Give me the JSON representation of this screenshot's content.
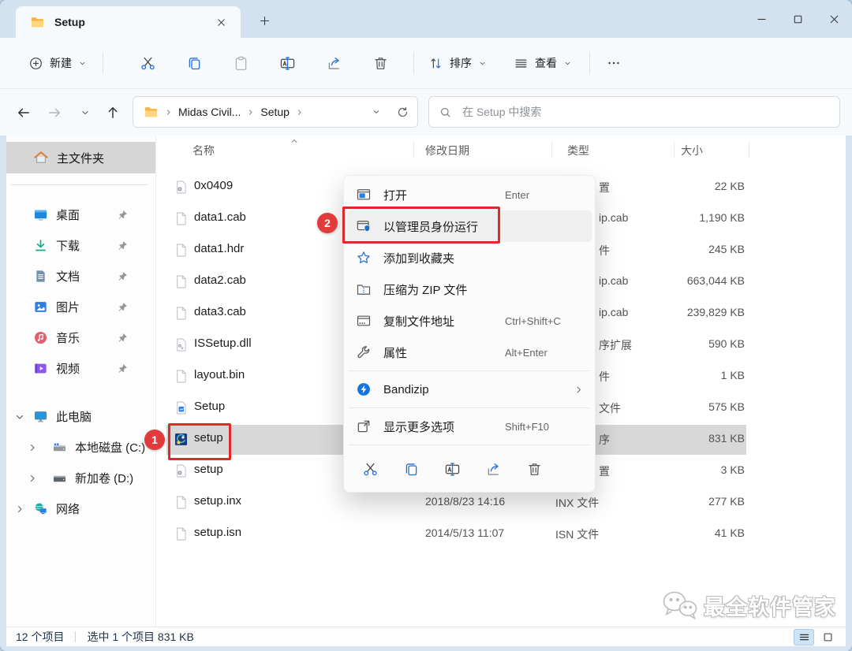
{
  "window": {
    "tab": {
      "title": "Setup"
    }
  },
  "toolbar": {
    "new_label": "新建",
    "sort_label": "排序",
    "view_label": "查看",
    "buttons": [
      {
        "name": "cut",
        "icon": "cut-icon",
        "enabled": true
      },
      {
        "name": "copy",
        "icon": "copy-icon",
        "enabled": true
      },
      {
        "name": "paste",
        "icon": "paste-icon",
        "enabled": false
      },
      {
        "name": "rename",
        "icon": "rename-icon",
        "enabled": true
      },
      {
        "name": "share",
        "icon": "share-icon",
        "enabled": true
      },
      {
        "name": "delete",
        "icon": "delete-icon",
        "enabled": true
      }
    ]
  },
  "address": {
    "crumbs": [
      "Midas Civil...",
      "Setup"
    ]
  },
  "search": {
    "placeholder": "在 Setup 中搜索"
  },
  "sidebar": {
    "home": {
      "label": "主文件夹"
    },
    "quick_items": [
      {
        "label": "桌面",
        "icon": "desktop-icon",
        "pinned": true
      },
      {
        "label": "下载",
        "icon": "downloads-icon",
        "pinned": true
      },
      {
        "label": "文档",
        "icon": "documents-icon",
        "pinned": true
      },
      {
        "label": "图片",
        "icon": "pictures-icon",
        "pinned": true
      },
      {
        "label": "音乐",
        "icon": "music-icon",
        "pinned": true
      },
      {
        "label": "视频",
        "icon": "videos-icon",
        "pinned": true
      }
    ],
    "tree_items": [
      {
        "label": "此电脑",
        "icon": "computer-icon",
        "chevron": "down",
        "indent": 0
      },
      {
        "label": "本地磁盘 (C:)",
        "icon": "disk-c-icon",
        "chevron": "right",
        "indent": 1
      },
      {
        "label": "新加卷 (D:)",
        "icon": "disk-d-icon",
        "chevron": "right",
        "indent": 1
      },
      {
        "label": "网络",
        "icon": "network-icon",
        "chevron": "right",
        "indent": 0
      }
    ]
  },
  "files": {
    "headers": {
      "name": "名称",
      "date": "修改日期",
      "type": "类型",
      "size": "大小"
    },
    "rows": [
      {
        "name": "0x0409",
        "icon": "config-file-icon",
        "type_fragment": "置",
        "size": "22 KB"
      },
      {
        "name": "data1.cab",
        "icon": "file-icon",
        "type_fragment": "ip.cab",
        "size": "1,190 KB"
      },
      {
        "name": "data1.hdr",
        "icon": "file-icon",
        "type_fragment": "件",
        "size": "245 KB"
      },
      {
        "name": "data2.cab",
        "icon": "file-icon",
        "type_fragment": "ip.cab",
        "size": "663,044 KB"
      },
      {
        "name": "data3.cab",
        "icon": "file-icon",
        "type_fragment": "ip.cab",
        "size": "239,829 KB"
      },
      {
        "name": "ISSetup.dll",
        "icon": "dll-file-icon",
        "type_fragment": "序扩展",
        "size": "590 KB"
      },
      {
        "name": "layout.bin",
        "icon": "file-icon",
        "type_fragment": "件",
        "size": "1 KB"
      },
      {
        "name": "Setup",
        "icon": "setup-doc-icon",
        "type_fragment": "文件",
        "size": "575 KB"
      },
      {
        "name": "setup",
        "icon": "setup-exe-icon",
        "type_fragment": "序",
        "size": "831 KB",
        "selected": true
      },
      {
        "name": "setup",
        "icon": "config-file-icon",
        "type_fragment": "置",
        "size": "3 KB"
      },
      {
        "name": "setup.inx",
        "icon": "file-icon",
        "date": "2018/8/23 14:16",
        "type": "INX 文件",
        "size": "277 KB"
      },
      {
        "name": "setup.isn",
        "icon": "file-icon",
        "date": "2014/5/13 11:07",
        "type": "ISN 文件",
        "size": "41 KB"
      }
    ]
  },
  "context_menu": {
    "items": [
      {
        "kind": "item",
        "name": "open",
        "icon": "open-window-icon",
        "label": "打开",
        "shortcut": "Enter"
      },
      {
        "kind": "item",
        "name": "run-as-administrator",
        "icon": "admin-shield-icon",
        "label": "以管理员身份运行",
        "highlighted": true
      },
      {
        "kind": "item",
        "name": "add-to-favorites",
        "icon": "star-icon",
        "label": "添加到收藏夹"
      },
      {
        "kind": "item",
        "name": "compress-to-zip",
        "icon": "zip-icon",
        "label": "压缩为 ZIP 文件"
      },
      {
        "kind": "item",
        "name": "copy-file-path",
        "icon": "copy-path-icon",
        "label": "复制文件地址",
        "shortcut": "Ctrl+Shift+C"
      },
      {
        "kind": "item",
        "name": "properties",
        "icon": "properties-icon",
        "label": "属性",
        "shortcut": "Alt+Enter"
      },
      {
        "kind": "divider"
      },
      {
        "kind": "item",
        "name": "bandizip",
        "icon": "bandizip-icon",
        "label": "Bandizip",
        "submenu": true
      },
      {
        "kind": "divider"
      },
      {
        "kind": "item",
        "name": "show-more-options",
        "icon": "show-more-icon",
        "label": "显示更多选项",
        "shortcut": "Shift+F10"
      },
      {
        "kind": "divider"
      },
      {
        "kind": "iconrow",
        "icons": [
          {
            "name": "cut",
            "icon": "cut-icon"
          },
          {
            "name": "copy",
            "icon": "copy-icon"
          },
          {
            "name": "rename",
            "icon": "rename-icon"
          },
          {
            "name": "share",
            "icon": "share-icon"
          },
          {
            "name": "delete",
            "icon": "delete-icon"
          }
        ]
      }
    ]
  },
  "annotations": {
    "step1": "1",
    "step2": "2",
    "accent_color": "#e02a2a"
  },
  "status_bar": {
    "items_count": "12 个项目",
    "selection": "选中 1 个项目  831 KB"
  },
  "watermark": {
    "text": "最全软件管家"
  }
}
